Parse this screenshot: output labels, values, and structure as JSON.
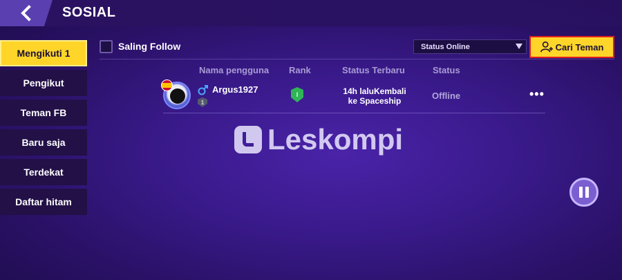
{
  "header": {
    "title": "SOSIAL",
    "back_icon": "chevron-left-icon"
  },
  "sidebar": {
    "items": [
      {
        "label": "Mengikuti 1",
        "active": true
      },
      {
        "label": "Pengikut",
        "active": false
      },
      {
        "label": "Teman FB",
        "active": false
      },
      {
        "label": "Baru saja",
        "active": false
      },
      {
        "label": "Terdekat",
        "active": false
      },
      {
        "label": "Daftar hitam",
        "active": false
      }
    ]
  },
  "filters": {
    "mutual_follow_label": "Saling Follow",
    "mutual_follow_checked": false,
    "status_select_value": "Status Online",
    "search_friend_label": "Cari Teman",
    "search_friend_icon": "add-user-icon"
  },
  "table": {
    "columns": [
      "Nama pengguna",
      "Rank",
      "Status Terbaru",
      "Status"
    ],
    "rows": [
      {
        "username": "Argus1927",
        "gender_icon": "male-icon",
        "level": "1",
        "rank": "I",
        "latest_status_line1": "14h laluKembali",
        "latest_status_line2": "ke Spaceship",
        "status": "Offline",
        "more_label": "•••"
      }
    ]
  },
  "watermark": {
    "text": "Leskompi"
  },
  "pause_icon": "pause-icon",
  "colors": {
    "accent_yellow": "#ffd52a",
    "highlight_red": "#e02020",
    "background_purple": "#3a1a8c"
  }
}
